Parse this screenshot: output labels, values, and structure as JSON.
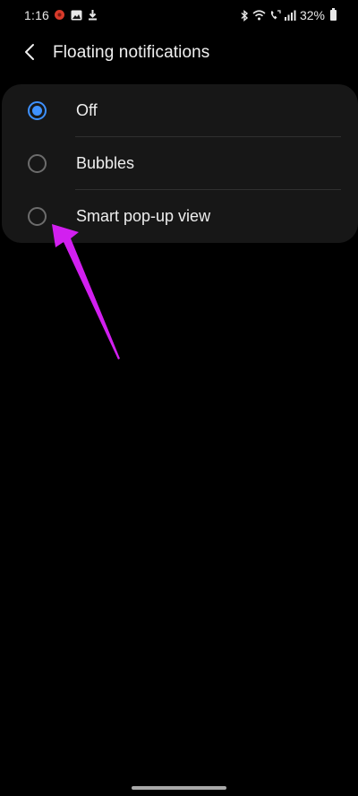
{
  "status_bar": {
    "time": "1:16",
    "left_icons": [
      "notification-app-icon",
      "gallery-icon",
      "download-icon"
    ],
    "right_icons": [
      "bluetooth-icon",
      "wifi-icon",
      "volte-call-icon",
      "signal-icon"
    ],
    "battery_percent": "32%"
  },
  "header": {
    "back_icon": "chevron-left-icon",
    "title": "Floating notifications"
  },
  "options": [
    {
      "label": "Off",
      "selected": true
    },
    {
      "label": "Bubbles",
      "selected": false
    },
    {
      "label": "Smart pop-up view",
      "selected": false
    }
  ],
  "colors": {
    "background": "#000000",
    "card": "#171717",
    "accent": "#3e91ff",
    "annotation_arrow": "#d21ff0"
  }
}
